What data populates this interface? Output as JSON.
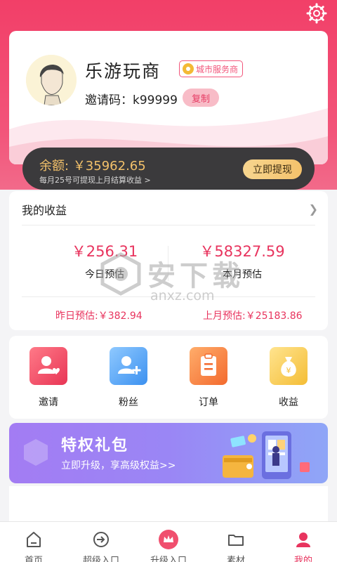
{
  "profile": {
    "name": "乐游玩商",
    "badge": "城市服务商",
    "invite_label": "邀请码：",
    "invite_code": "k99999",
    "copy_label": "复制"
  },
  "balance": {
    "label": "余额:",
    "amount": "￥35962.65",
    "note": "每月25号可提现上月结算收益 >",
    "withdraw_label": "立即提现"
  },
  "earnings": {
    "title": "我的收益",
    "today_value": "￥256.31",
    "today_label": "今日预估",
    "month_value": "￥58327.59",
    "month_label": "本月预估",
    "yesterday": "昨日预估:￥382.94",
    "last_month": "上月预估:￥25183.86"
  },
  "quick_actions": [
    {
      "label": "邀请",
      "icon": "invite-user-icon"
    },
    {
      "label": "粉丝",
      "icon": "add-user-icon"
    },
    {
      "label": "订单",
      "icon": "order-clipboard-icon"
    },
    {
      "label": "收益",
      "icon": "money-bag-icon"
    }
  ],
  "promo": {
    "title": "特权礼包",
    "subtitle": "立即升级，享高级权益>>"
  },
  "watermark": {
    "text": "安下载",
    "sub": "anxz.com"
  },
  "tabs": [
    {
      "label": "首页",
      "icon": "home-icon"
    },
    {
      "label": "超级入口",
      "icon": "enter-icon"
    },
    {
      "label": "升级入口",
      "icon": "crown-icon"
    },
    {
      "label": "素材",
      "icon": "folder-icon"
    },
    {
      "label": "我的",
      "icon": "user-icon",
      "active": true
    }
  ],
  "colors": {
    "brand": "#f23f68",
    "accent_gold": "#f3c16a",
    "price": "#e8345e"
  }
}
